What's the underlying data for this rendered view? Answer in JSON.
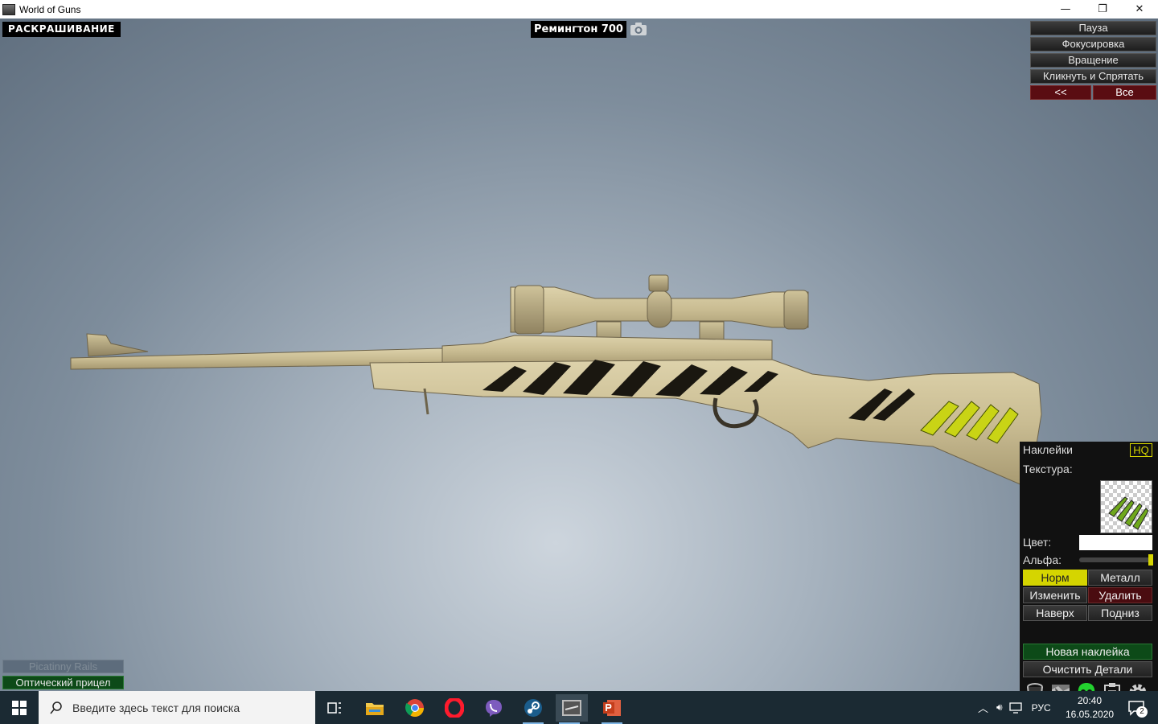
{
  "window": {
    "title": "World of Guns",
    "controls": [
      "—",
      "❐",
      "✕"
    ]
  },
  "viewport": {
    "mode_label": "РАСКРАШИВАНИЕ",
    "weapon_name": "Ремингтон 700",
    "camera_icon": "camera-icon"
  },
  "right_menu": {
    "pause": "Пауза",
    "focus": "Фокусировка",
    "rotate": "Вращение",
    "click_hide": "Кликнуть и Спрятать",
    "back": "<<",
    "all": "Все"
  },
  "decal_panel": {
    "header": "Наклейки",
    "hq": "HQ",
    "texture_label": "Текстура:",
    "color_label": "Цвет:",
    "alpha_label": "Альфа:",
    "alpha_value": 1.0,
    "color_value": "#ffffff",
    "mode_norm": "Норм",
    "mode_metal": "Металл",
    "edit": "Изменить",
    "delete": "Удалить",
    "up": "Наверх",
    "down": "Подниз",
    "new_decal": "Новая наклейка",
    "clear_details": "Очистить Детали",
    "tools": [
      "paint-bucket-icon",
      "camo-icon",
      "skull-icon",
      "clipboard-icon",
      "gear-icon"
    ]
  },
  "parts": {
    "disabled": "Picatinny Rails",
    "active": "Оптический прицел"
  },
  "taskbar": {
    "search_placeholder": "Введите здесь текст для поиска",
    "apps": [
      "task-view-icon",
      "file-explorer-icon",
      "chrome-icon",
      "opera-icon",
      "viber-icon",
      "steam-icon",
      "world-of-guns-icon",
      "powerpoint-icon"
    ],
    "lang": "РУС",
    "time": "20:40",
    "date": "16.05.2020",
    "notifications": "2"
  },
  "colors": {
    "accent_yellow": "#d5d500",
    "green_button": "#0d4a18",
    "red_button": "#5a0d12",
    "rifle_tan": "#cbbf96"
  }
}
